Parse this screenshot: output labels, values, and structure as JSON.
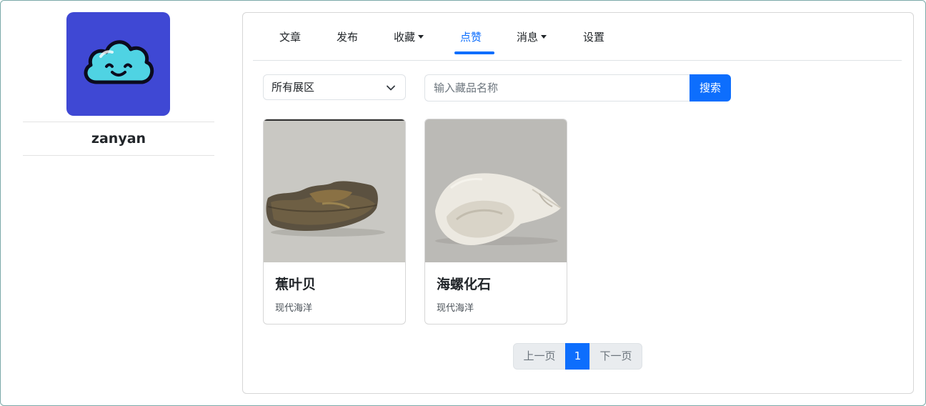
{
  "profile": {
    "username": "zanyan",
    "avatar_icon": "smiling-cloud-icon",
    "avatar_bg": "#3f48d4"
  },
  "tabs": [
    {
      "label": "文章",
      "active": false
    },
    {
      "label": "发布",
      "active": false
    },
    {
      "label": "收藏",
      "active": false,
      "dropdown": true
    },
    {
      "label": "点赞",
      "active": true
    },
    {
      "label": "消息",
      "active": false,
      "dropdown": true
    },
    {
      "label": "设置",
      "active": false
    }
  ],
  "filters": {
    "zone_select_value": "所有展区",
    "search_placeholder": "输入藏品名称",
    "search_button": "搜索"
  },
  "items": [
    {
      "name": "蕉叶贝",
      "zone": "现代海洋",
      "image_icon": "fossil-rock-image"
    },
    {
      "name": "海螺化石",
      "zone": "现代海洋",
      "image_icon": "conch-shell-image"
    }
  ],
  "pagination": {
    "prev": "上一页",
    "current": "1",
    "next": "下一页"
  },
  "colors": {
    "accent": "#0d6efd"
  }
}
